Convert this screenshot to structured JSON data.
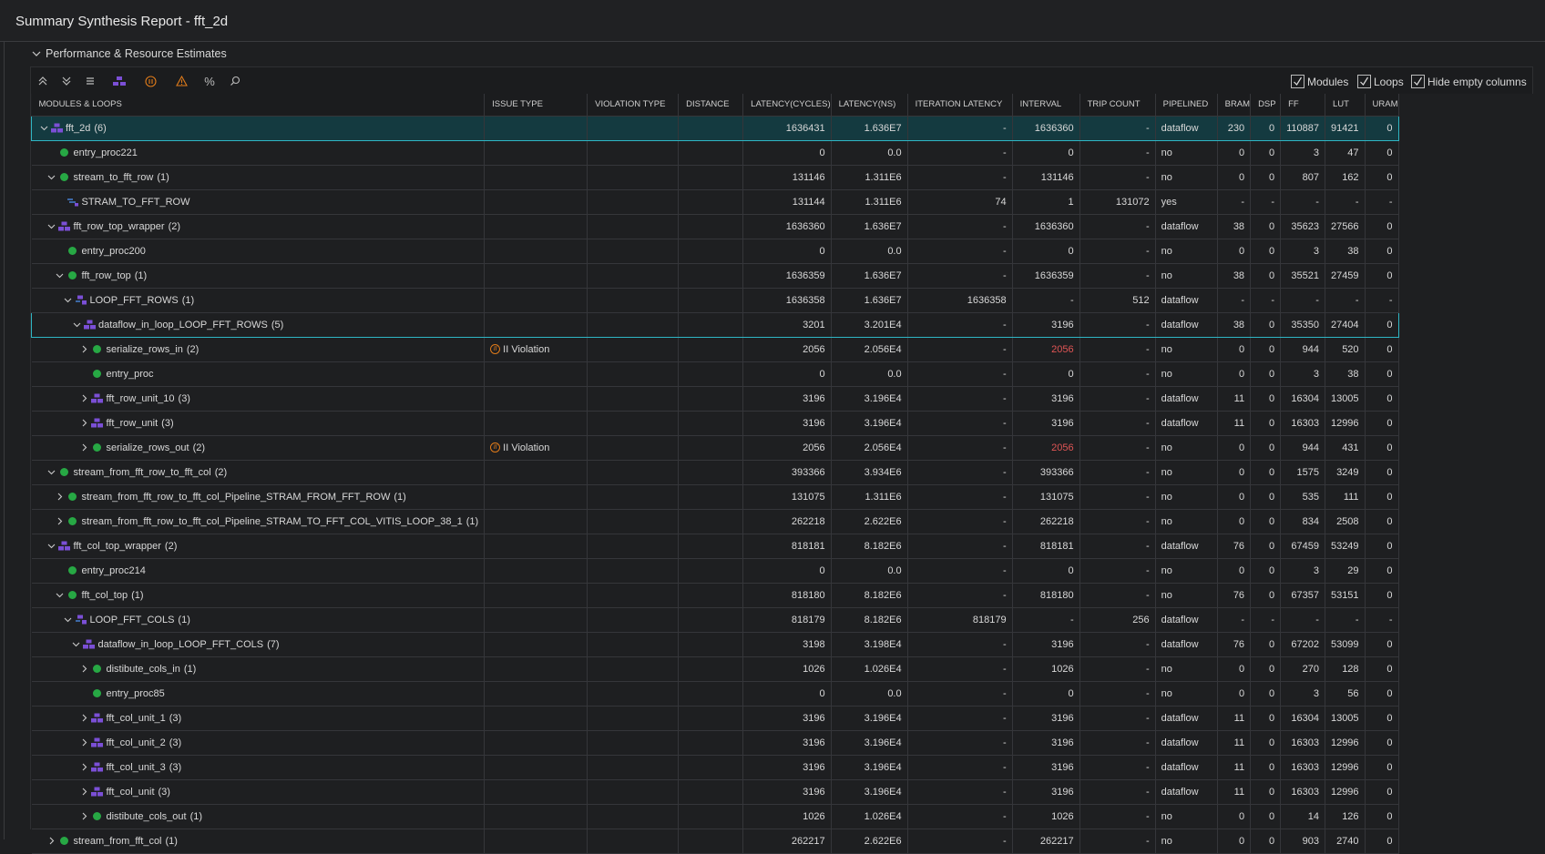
{
  "window": {
    "title": "Summary Synthesis Report - fft_2d"
  },
  "section": {
    "title": "Performance & Resource Estimates"
  },
  "toolbar": {
    "checkboxes": [
      {
        "label": "Modules",
        "checked": true
      },
      {
        "label": "Loops",
        "checked": true
      },
      {
        "label": "Hide empty columns",
        "checked": true
      }
    ],
    "icons": [
      "collapse-all-icon",
      "expand-all-icon",
      "list-icon",
      "module-hierarchy-icon",
      "ii-violation-filter-icon",
      "warning-filter-icon",
      "percent-icon",
      "search-icon"
    ]
  },
  "colors": {
    "accent": "#2fb6c4",
    "module": "#7b4fd6",
    "ok": "#27a844",
    "violation": "#e07b1a",
    "error": "#e05555"
  },
  "table": {
    "headers": [
      "MODULES & LOOPS",
      "ISSUE TYPE",
      "VIOLATION TYPE",
      "DISTANCE",
      "LATENCY(CYCLES)",
      "LATENCY(NS)",
      "ITERATION LATENCY",
      "INTERVAL",
      "TRIP COUNT",
      "PIPELINED",
      "BRAM",
      "DSP",
      "FF",
      "LUT",
      "URAM"
    ],
    "rows": [
      {
        "depth": 0,
        "arrow": "down",
        "icon": "module",
        "name": "fft_2d",
        "count": "(6)",
        "issue": "",
        "lat": "1636431",
        "latns": "1.636E7",
        "iter": "-",
        "interval": "1636360",
        "trip": "-",
        "pipe": "dataflow",
        "bram": "230",
        "dsp": "0",
        "ff": "110887",
        "lut": "91421",
        "uram": "0"
      },
      {
        "depth": 1,
        "arrow": "",
        "icon": "dot",
        "name": "entry_proc221",
        "count": "",
        "issue": "",
        "lat": "0",
        "latns": "0.0",
        "iter": "-",
        "interval": "0",
        "trip": "-",
        "pipe": "no",
        "bram": "0",
        "dsp": "0",
        "ff": "3",
        "lut": "47",
        "uram": "0"
      },
      {
        "depth": 1,
        "arrow": "down",
        "icon": "dot",
        "name": "stream_to_fft_row",
        "count": "(1)",
        "issue": "",
        "lat": "131146",
        "latns": "1.311E6",
        "iter": "-",
        "interval": "131146",
        "trip": "-",
        "pipe": "no",
        "bram": "0",
        "dsp": "0",
        "ff": "807",
        "lut": "162",
        "uram": "0"
      },
      {
        "depth": 2,
        "arrow": "",
        "icon": "loop",
        "name": "STRAM_TO_FFT_ROW",
        "count": "",
        "issue": "",
        "lat": "131144",
        "latns": "1.311E6",
        "iter": "74",
        "interval": "1",
        "trip": "131072",
        "pipe": "yes",
        "bram": "-",
        "dsp": "-",
        "ff": "-",
        "lut": "-",
        "uram": "-"
      },
      {
        "depth": 1,
        "arrow": "down",
        "icon": "module",
        "name": "fft_row_top_wrapper",
        "count": "(2)",
        "issue": "",
        "lat": "1636360",
        "latns": "1.636E7",
        "iter": "-",
        "interval": "1636360",
        "trip": "-",
        "pipe": "dataflow",
        "bram": "38",
        "dsp": "0",
        "ff": "35623",
        "lut": "27566",
        "uram": "0"
      },
      {
        "depth": 2,
        "arrow": "",
        "icon": "dot",
        "name": "entry_proc200",
        "count": "",
        "issue": "",
        "lat": "0",
        "latns": "0.0",
        "iter": "-",
        "interval": "0",
        "trip": "-",
        "pipe": "no",
        "bram": "0",
        "dsp": "0",
        "ff": "3",
        "lut": "38",
        "uram": "0"
      },
      {
        "depth": 2,
        "arrow": "down",
        "icon": "dot",
        "name": "fft_row_top",
        "count": "(1)",
        "issue": "",
        "lat": "1636359",
        "latns": "1.636E7",
        "iter": "-",
        "interval": "1636359",
        "trip": "-",
        "pipe": "no",
        "bram": "38",
        "dsp": "0",
        "ff": "35521",
        "lut": "27459",
        "uram": "0"
      },
      {
        "depth": 3,
        "arrow": "down",
        "icon": "loopmod",
        "name": "LOOP_FFT_ROWS",
        "count": "(1)",
        "issue": "",
        "lat": "1636358",
        "latns": "1.636E7",
        "iter": "1636358",
        "interval": "-",
        "trip": "512",
        "pipe": "dataflow",
        "bram": "-",
        "dsp": "-",
        "ff": "-",
        "lut": "-",
        "uram": "-"
      },
      {
        "depth": 4,
        "arrow": "down",
        "icon": "module",
        "name": "dataflow_in_loop_LOOP_FFT_ROWS",
        "count": "(5)",
        "issue": "",
        "lat": "3201",
        "latns": "3.201E4",
        "iter": "-",
        "interval": "3196",
        "trip": "-",
        "pipe": "dataflow",
        "bram": "38",
        "dsp": "0",
        "ff": "35350",
        "lut": "27404",
        "uram": "0"
      },
      {
        "depth": 5,
        "arrow": "right",
        "icon": "dot",
        "name": "serialize_rows_in",
        "count": "(2)",
        "issue": "II Violation",
        "lat": "2056",
        "latns": "2.056E4",
        "iter": "-",
        "interval": "2056",
        "trip": "-",
        "pipe": "no",
        "bram": "0",
        "dsp": "0",
        "ff": "944",
        "lut": "520",
        "uram": "0"
      },
      {
        "depth": 5,
        "arrow": "",
        "icon": "dot",
        "name": "entry_proc",
        "count": "",
        "issue": "",
        "lat": "0",
        "latns": "0.0",
        "iter": "-",
        "interval": "0",
        "trip": "-",
        "pipe": "no",
        "bram": "0",
        "dsp": "0",
        "ff": "3",
        "lut": "38",
        "uram": "0"
      },
      {
        "depth": 5,
        "arrow": "right",
        "icon": "module",
        "name": "fft_row_unit_10",
        "count": "(3)",
        "issue": "",
        "lat": "3196",
        "latns": "3.196E4",
        "iter": "-",
        "interval": "3196",
        "trip": "-",
        "pipe": "dataflow",
        "bram": "11",
        "dsp": "0",
        "ff": "16304",
        "lut": "13005",
        "uram": "0"
      },
      {
        "depth": 5,
        "arrow": "right",
        "icon": "module",
        "name": "fft_row_unit",
        "count": "(3)",
        "issue": "",
        "lat": "3196",
        "latns": "3.196E4",
        "iter": "-",
        "interval": "3196",
        "trip": "-",
        "pipe": "dataflow",
        "bram": "11",
        "dsp": "0",
        "ff": "16303",
        "lut": "12996",
        "uram": "0"
      },
      {
        "depth": 5,
        "arrow": "right",
        "icon": "dot",
        "name": "serialize_rows_out",
        "count": "(2)",
        "issue": "II Violation",
        "lat": "2056",
        "latns": "2.056E4",
        "iter": "-",
        "interval": "2056",
        "trip": "-",
        "pipe": "no",
        "bram": "0",
        "dsp": "0",
        "ff": "944",
        "lut": "431",
        "uram": "0"
      },
      {
        "depth": 1,
        "arrow": "down",
        "icon": "dot",
        "name": "stream_from_fft_row_to_fft_col",
        "count": "(2)",
        "issue": "",
        "lat": "393366",
        "latns": "3.934E6",
        "iter": "-",
        "interval": "393366",
        "trip": "-",
        "pipe": "no",
        "bram": "0",
        "dsp": "0",
        "ff": "1575",
        "lut": "3249",
        "uram": "0"
      },
      {
        "depth": 2,
        "arrow": "right",
        "icon": "dot",
        "name": "stream_from_fft_row_to_fft_col_Pipeline_STRAM_FROM_FFT_ROW",
        "count": "(1)",
        "issue": "",
        "lat": "131075",
        "latns": "1.311E6",
        "iter": "-",
        "interval": "131075",
        "trip": "-",
        "pipe": "no",
        "bram": "0",
        "dsp": "0",
        "ff": "535",
        "lut": "111",
        "uram": "0"
      },
      {
        "depth": 2,
        "arrow": "right",
        "icon": "dot",
        "name": "stream_from_fft_row_to_fft_col_Pipeline_STRAM_TO_FFT_COL_VITIS_LOOP_38_1",
        "count": "(1)",
        "issue": "",
        "lat": "262218",
        "latns": "2.622E6",
        "iter": "-",
        "interval": "262218",
        "trip": "-",
        "pipe": "no",
        "bram": "0",
        "dsp": "0",
        "ff": "834",
        "lut": "2508",
        "uram": "0"
      },
      {
        "depth": 1,
        "arrow": "down",
        "icon": "module",
        "name": "fft_col_top_wrapper",
        "count": "(2)",
        "issue": "",
        "lat": "818181",
        "latns": "8.182E6",
        "iter": "-",
        "interval": "818181",
        "trip": "-",
        "pipe": "dataflow",
        "bram": "76",
        "dsp": "0",
        "ff": "67459",
        "lut": "53249",
        "uram": "0"
      },
      {
        "depth": 2,
        "arrow": "",
        "icon": "dot",
        "name": "entry_proc214",
        "count": "",
        "issue": "",
        "lat": "0",
        "latns": "0.0",
        "iter": "-",
        "interval": "0",
        "trip": "-",
        "pipe": "no",
        "bram": "0",
        "dsp": "0",
        "ff": "3",
        "lut": "29",
        "uram": "0"
      },
      {
        "depth": 2,
        "arrow": "down",
        "icon": "dot",
        "name": "fft_col_top",
        "count": "(1)",
        "issue": "",
        "lat": "818180",
        "latns": "8.182E6",
        "iter": "-",
        "interval": "818180",
        "trip": "-",
        "pipe": "no",
        "bram": "76",
        "dsp": "0",
        "ff": "67357",
        "lut": "53151",
        "uram": "0"
      },
      {
        "depth": 3,
        "arrow": "down",
        "icon": "loopmod",
        "name": "LOOP_FFT_COLS",
        "count": "(1)",
        "issue": "",
        "lat": "818179",
        "latns": "8.182E6",
        "iter": "818179",
        "interval": "-",
        "trip": "256",
        "pipe": "dataflow",
        "bram": "-",
        "dsp": "-",
        "ff": "-",
        "lut": "-",
        "uram": "-"
      },
      {
        "depth": 4,
        "arrow": "down",
        "icon": "module",
        "name": "dataflow_in_loop_LOOP_FFT_COLS",
        "count": "(7)",
        "issue": "",
        "lat": "3198",
        "latns": "3.198E4",
        "iter": "-",
        "interval": "3196",
        "trip": "-",
        "pipe": "dataflow",
        "bram": "76",
        "dsp": "0",
        "ff": "67202",
        "lut": "53099",
        "uram": "0"
      },
      {
        "depth": 5,
        "arrow": "right",
        "icon": "dot",
        "name": "distibute_cols_in",
        "count": "(1)",
        "issue": "",
        "lat": "1026",
        "latns": "1.026E4",
        "iter": "-",
        "interval": "1026",
        "trip": "-",
        "pipe": "no",
        "bram": "0",
        "dsp": "0",
        "ff": "270",
        "lut": "128",
        "uram": "0"
      },
      {
        "depth": 5,
        "arrow": "",
        "icon": "dot",
        "name": "entry_proc85",
        "count": "",
        "issue": "",
        "lat": "0",
        "latns": "0.0",
        "iter": "-",
        "interval": "0",
        "trip": "-",
        "pipe": "no",
        "bram": "0",
        "dsp": "0",
        "ff": "3",
        "lut": "56",
        "uram": "0"
      },
      {
        "depth": 5,
        "arrow": "right",
        "icon": "module",
        "name": "fft_col_unit_1",
        "count": "(3)",
        "issue": "",
        "lat": "3196",
        "latns": "3.196E4",
        "iter": "-",
        "interval": "3196",
        "trip": "-",
        "pipe": "dataflow",
        "bram": "11",
        "dsp": "0",
        "ff": "16304",
        "lut": "13005",
        "uram": "0"
      },
      {
        "depth": 5,
        "arrow": "right",
        "icon": "module",
        "name": "fft_col_unit_2",
        "count": "(3)",
        "issue": "",
        "lat": "3196",
        "latns": "3.196E4",
        "iter": "-",
        "interval": "3196",
        "trip": "-",
        "pipe": "dataflow",
        "bram": "11",
        "dsp": "0",
        "ff": "16303",
        "lut": "12996",
        "uram": "0"
      },
      {
        "depth": 5,
        "arrow": "right",
        "icon": "module",
        "name": "fft_col_unit_3",
        "count": "(3)",
        "issue": "",
        "lat": "3196",
        "latns": "3.196E4",
        "iter": "-",
        "interval": "3196",
        "trip": "-",
        "pipe": "dataflow",
        "bram": "11",
        "dsp": "0",
        "ff": "16303",
        "lut": "12996",
        "uram": "0"
      },
      {
        "depth": 5,
        "arrow": "right",
        "icon": "module",
        "name": "fft_col_unit",
        "count": "(3)",
        "issue": "",
        "lat": "3196",
        "latns": "3.196E4",
        "iter": "-",
        "interval": "3196",
        "trip": "-",
        "pipe": "dataflow",
        "bram": "11",
        "dsp": "0",
        "ff": "16303",
        "lut": "12996",
        "uram": "0"
      },
      {
        "depth": 5,
        "arrow": "right",
        "icon": "dot",
        "name": "distibute_cols_out",
        "count": "(1)",
        "issue": "",
        "lat": "1026",
        "latns": "1.026E4",
        "iter": "-",
        "interval": "1026",
        "trip": "-",
        "pipe": "no",
        "bram": "0",
        "dsp": "0",
        "ff": "14",
        "lut": "126",
        "uram": "0"
      },
      {
        "depth": 1,
        "arrow": "right",
        "icon": "dot",
        "name": "stream_from_fft_col",
        "count": "(1)",
        "issue": "",
        "lat": "262217",
        "latns": "2.622E6",
        "iter": "-",
        "interval": "262217",
        "trip": "-",
        "pipe": "no",
        "bram": "0",
        "dsp": "0",
        "ff": "903",
        "lut": "2740",
        "uram": "0"
      }
    ]
  }
}
